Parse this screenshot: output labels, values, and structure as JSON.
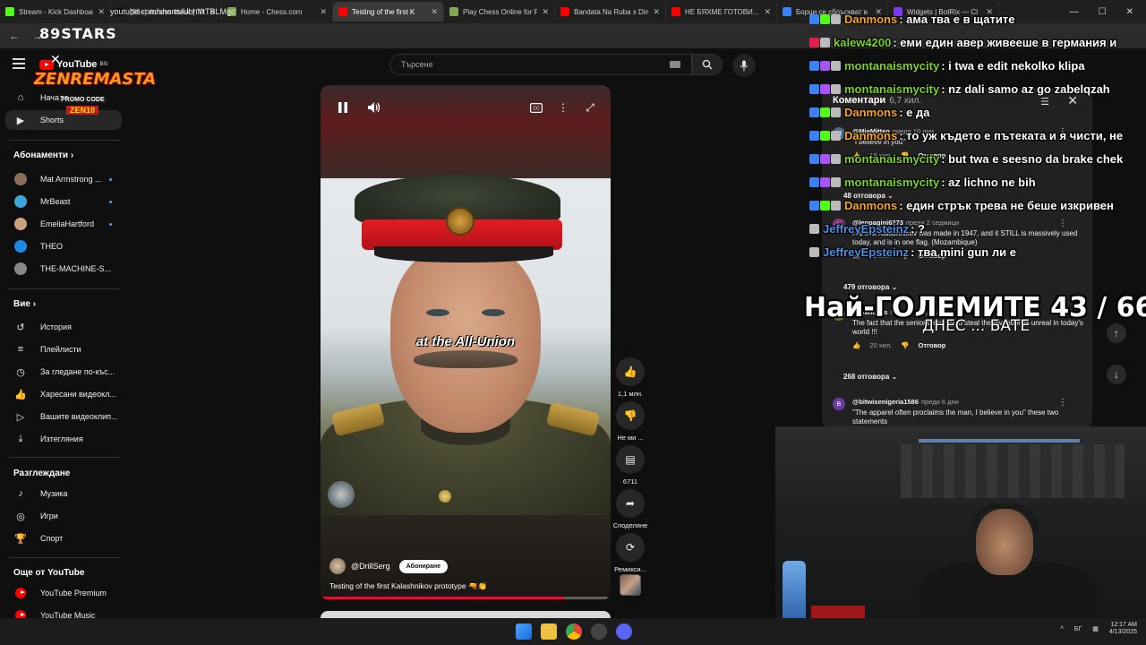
{
  "browser": {
    "tabs": [
      {
        "title": "Stream - Kick Dashboard",
        "color": "#53fc18"
      },
      {
        "title": "(99+) #chess #task | TikT",
        "color": "#111111"
      },
      {
        "title": "Home - Chess.com",
        "color": "#7fa650"
      },
      {
        "title": "Testing of the first K",
        "color": "#ff0000",
        "active": true
      },
      {
        "title": "Play Chess Online for FR",
        "color": "#7fa650"
      },
      {
        "title": "Bandata Na Ruba x Dim",
        "color": "#ff0000"
      },
      {
        "title": "НЕ БЯХМЕ ГОТОВИ...",
        "color": "#ff0000"
      },
      {
        "title": "Борци се сблъскват в",
        "color": "#3b82f6"
      },
      {
        "title": "Widgets | BotRix — Cl",
        "color": "#7c3aed"
      }
    ],
    "url": "youtube.com/shorts/UbhYtTBLMgc"
  },
  "overlay_logo": {
    "stars": "89STARS",
    "name": "ZENREMASTA",
    "promo": "PROMO CODE",
    "code": "ZEN10"
  },
  "header": {
    "logo_text": "YouTube",
    "logo_region": "BG",
    "search_placeholder": "Търсене"
  },
  "sidebar": {
    "main": [
      {
        "label": "Начало",
        "icon": "home-icon"
      },
      {
        "label": "Shorts",
        "icon": "shorts-icon",
        "active": true
      }
    ],
    "subscriptions_title": "Абонаменти",
    "subscriptions": [
      {
        "label": "Mat Armstrong ...",
        "color": "#8a6d5a"
      },
      {
        "label": "MrBeast",
        "color": "#3aa6d9"
      },
      {
        "label": "EmeliaHartford",
        "color": "#c9a07a"
      },
      {
        "label": "THEO",
        "color": "#1e88e5"
      },
      {
        "label": "THE-MACHINE-S...",
        "color": "#888888"
      }
    ],
    "you_title": "Вие",
    "you": [
      {
        "label": "История",
        "icon": "history-icon"
      },
      {
        "label": "Плейлисти",
        "icon": "playlist-icon"
      },
      {
        "label": "За гледане по-къс...",
        "icon": "watch-later-icon"
      },
      {
        "label": "Харесани видеокл...",
        "icon": "liked-icon"
      },
      {
        "label": "Вашите видеоклип...",
        "icon": "your-videos-icon"
      },
      {
        "label": "Изтегляния",
        "icon": "download-icon"
      }
    ],
    "explore_title": "Разглеждане",
    "explore": [
      {
        "label": "Музика",
        "icon": "music-icon"
      },
      {
        "label": "Игри",
        "icon": "games-icon"
      },
      {
        "label": "Спорт",
        "icon": "sports-icon"
      }
    ],
    "more_title": "Още от YouTube",
    "more": [
      {
        "label": "YouTube Premium"
      },
      {
        "label": "YouTube Music"
      }
    ]
  },
  "video": {
    "subtitle": "at the All-Union",
    "channel": "@DrillSerg",
    "subscribe": "Абониране",
    "title": "Testing of the first Kalashnikov prototype 🔫👏",
    "progress": 0.84
  },
  "actions": {
    "likes": "1,1 млн.",
    "dislike": "Не ми ...",
    "comments": "6711",
    "share": "Споделяне",
    "remix": "Ремикси..."
  },
  "comments": {
    "title": "Коментари",
    "count": "6,7 хил.",
    "items": [
      {
        "user": "@MiaMitten",
        "time": "преди 10 дни",
        "text": "\"I believe in you\"",
        "likes": "19 хил.",
        "replies": "48 отговора"
      },
      {
        "user": "@leopagini6273",
        "time": "преди 2 седмици",
        "text": "His first Kalashnikov was made in 1947, and it STILL is massively used today, and is in one flag. (Mozambique)",
        "likes": "72 хил.",
        "replies": "479 отговора"
      },
      {
        "user": "@ivanosas",
        "time": "преди 1 седмица",
        "text": "The fact that the senior didn't try to steal the invention is unreal in today's world !!!",
        "likes": "20 хил.",
        "replies": "268 отговора"
      },
      {
        "user": "@bitwisenigeria1586",
        "time": "преди 6 дни",
        "text": "\"The apparel often proclaims the man, I believe in you\" these two statements"
      }
    ],
    "reply_label": "Отговор"
  },
  "chat": [
    {
      "user": "Danmons",
      "color": "#f5a623",
      "msg": ": ама тва е в щатите"
    },
    {
      "user": "kalew4200",
      "color": "#7ed321",
      "msg": ": еми един авер живееше в германия и"
    },
    {
      "user": "montanaismycity",
      "color": "#7ed321",
      "msg": ": i twa e edit nekolko klipa"
    },
    {
      "user": "montanaismycity",
      "color": "#7ed321",
      "msg": ": nz dali samo az go zabelqzah"
    },
    {
      "user": "Danmons",
      "color": "#f5a623",
      "msg": ": е да"
    },
    {
      "user": "Danmons",
      "color": "#f5a623",
      "msg": ": то уж където е пътеката и я чисти, не"
    },
    {
      "user": "montanaismycity",
      "color": "#7ed321",
      "msg": ": but twa e seesno da brake chek"
    },
    {
      "user": "montanaismycity",
      "color": "#7ed321",
      "msg": ": az lichno ne bih"
    },
    {
      "user": "Danmons",
      "color": "#f5a623",
      "msg": ": един стрък трева не беше изкривен"
    },
    {
      "user": "JeffreyEpsteinz",
      "color": "#4a90e2",
      "msg": ": ?"
    },
    {
      "user": "JeffreyEpsteinz",
      "color": "#4a90e2",
      "msg": ": тва mini gun ли е"
    }
  ],
  "goal": {
    "text": "Най-ГОЛЕМИТЕ 43 / 66",
    "sub": "ДНЕС ... БАТЕ"
  },
  "tray": {
    "lang": "БГ",
    "time": "12:17 AM",
    "date": "4/13/2025"
  }
}
